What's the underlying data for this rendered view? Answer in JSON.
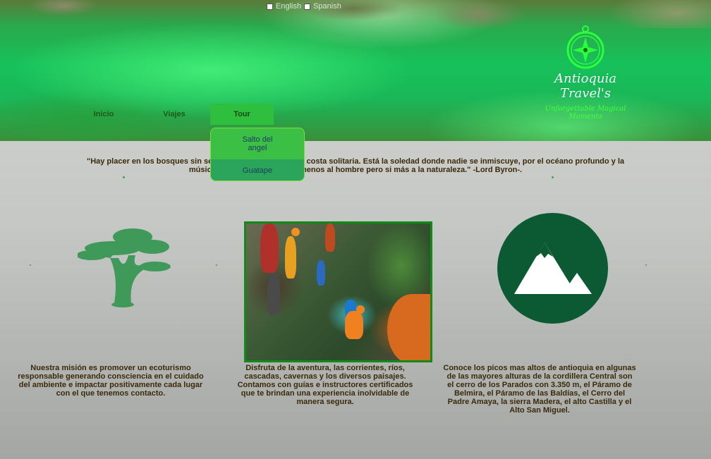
{
  "header": {
    "lang_english": "English",
    "lang_spanish": "Spanish",
    "brand": "Antioquia Travel's",
    "tagline": "Unforgettable Magical Moments"
  },
  "nav": {
    "items": [
      {
        "label": "Inicio"
      },
      {
        "label": "Viajes"
      },
      {
        "label": "Tour"
      }
    ],
    "dropdown": [
      {
        "label": "Salto del angel"
      },
      {
        "label": "Guatape"
      }
    ]
  },
  "quote": {
    "text": "\"Hay placer en los bosques sin senderos, hay éxtasis en la costa solitaria. Está la soledad donde nadie se inmiscuye, por el océano profundo y la música en su rugido: No amo menos al hombre pero si más a la naturaleza.\" -Lord Byron-."
  },
  "columns": [
    {
      "icon": "tree-icon",
      "text": "Nuestra misión es promover un ecoturismo responsable generando consciencia en el cuidado del ambiente e impactar positivamente cada lugar con el que tenemos contacto."
    },
    {
      "icon": "canyoning-photo",
      "text": "Disfruta de la aventura, las corrientes, ríos, cascadas, cavernas y los diversos paisajes. Contamos con guías e instructores certificados que te brindan una experiencia inolvidable de manera segura."
    },
    {
      "icon": "mountain-icon",
      "text": "Conoce los picos mas altos de antioquia en algunas de las mayores alturas de la cordillera Central son el cerro de los Parados con 3.350 m, el Páramo de Belmira, el Páramo de las Baldías, el Cerro del Padre Amaya, la sierra Madera, el alto Castilla y el Alto San Miguel."
    }
  ],
  "colors": {
    "accent_green": "#2fbf3f",
    "icon_green": "#3f9a5a",
    "dark_green": "#0b5a33",
    "text_brown": "#3b2a0a"
  }
}
